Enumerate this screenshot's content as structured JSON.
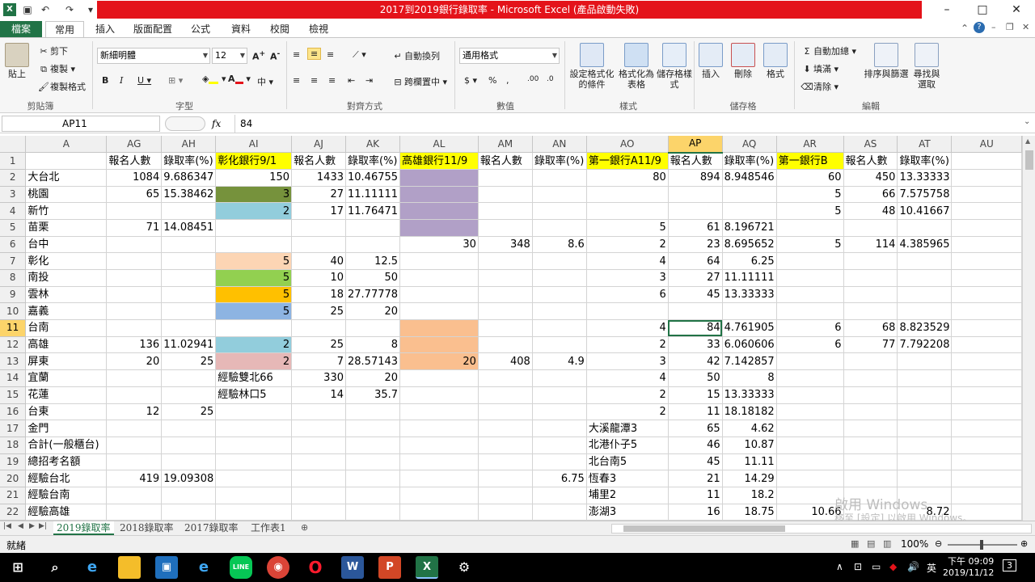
{
  "window": {
    "title": "2017到2019銀行錄取率 - Microsoft Excel (產品啟動失敗)",
    "controls": [
      "–",
      "□",
      "✕"
    ]
  },
  "ribbon_tabs": [
    "檔案",
    "常用",
    "插入",
    "版面配置",
    "公式",
    "資料",
    "校閱",
    "檢視"
  ],
  "ribbon": {
    "clipboard": {
      "paste": "貼上",
      "cut": "剪下",
      "copy": "複製",
      "format_painter": "複製格式",
      "label": "剪貼簿"
    },
    "font": {
      "name": "新細明體",
      "size": "12",
      "label": "字型"
    },
    "alignment": {
      "wrap": "自動換列",
      "merge": "跨欄置中",
      "label": "對齊方式"
    },
    "number": {
      "format": "通用格式",
      "label": "數值"
    },
    "styles": {
      "conditional": "設定格式化的條件",
      "table": "格式化為表格",
      "cell_styles": "儲存格樣式",
      "label": "樣式"
    },
    "cells": {
      "insert": "插入",
      "delete": "刪除",
      "format": "格式",
      "label": "儲存格"
    },
    "editing": {
      "autosum": "自動加總",
      "fill": "填滿",
      "clear": "清除",
      "sort": "排序與篩選",
      "find": "尋找與選取",
      "label": "編輯"
    }
  },
  "formula_bar": {
    "name_box": "AP11",
    "fx": "fx",
    "value": "84"
  },
  "columns": [
    "A",
    "AG",
    "AH",
    "AI",
    "AJ",
    "AK",
    "AL",
    "AM",
    "AN",
    "AO",
    "AP",
    "AQ",
    "AR",
    "AS",
    "AT",
    "AU"
  ],
  "rows": [
    [
      "",
      "報名人數",
      "錄取率(%)",
      "彰化銀行9/1",
      "報名人數",
      "錄取率(%)",
      "高雄銀行11/9",
      "報名人數",
      "錄取率(%)",
      "第一銀行A11/9",
      "報名人數",
      "錄取率(%)",
      "第一銀行B",
      "報名人數",
      "錄取率(%)",
      ""
    ],
    [
      "大台北",
      "1084",
      "9.686347",
      "150",
      "1433",
      "10.46755",
      "",
      "",
      "",
      "80",
      "894",
      "8.948546",
      "60",
      "450",
      "13.33333",
      ""
    ],
    [
      "桃園",
      "65",
      "15.38462",
      "3",
      "27",
      "11.11111",
      "",
      "",
      "",
      "",
      "",
      "",
      "5",
      "66",
      "7.575758",
      ""
    ],
    [
      "新竹",
      "",
      "",
      "2",
      "17",
      "11.76471",
      "",
      "",
      "",
      "",
      "",
      "",
      "5",
      "48",
      "10.41667",
      ""
    ],
    [
      "苗栗",
      "71",
      "14.08451",
      "",
      "",
      "",
      "",
      "",
      "",
      "5",
      "61",
      "8.196721",
      "",
      "",
      "",
      ""
    ],
    [
      "台中",
      "",
      "",
      "",
      "",
      "",
      "30",
      "348",
      "8.6",
      "2",
      "23",
      "8.695652",
      "5",
      "114",
      "4.385965",
      ""
    ],
    [
      "彰化",
      "",
      "",
      "5",
      "40",
      "12.5",
      "",
      "",
      "",
      "4",
      "64",
      "6.25",
      "",
      "",
      "",
      ""
    ],
    [
      "南投",
      "",
      "",
      "5",
      "10",
      "50",
      "",
      "",
      "",
      "3",
      "27",
      "11.11111",
      "",
      "",
      "",
      ""
    ],
    [
      "雲林",
      "",
      "",
      "5",
      "18",
      "27.77778",
      "",
      "",
      "",
      "6",
      "45",
      "13.33333",
      "",
      "",
      "",
      ""
    ],
    [
      "嘉義",
      "",
      "",
      "5",
      "25",
      "20",
      "",
      "",
      "",
      "",
      "",
      "",
      "",
      "",
      "",
      ""
    ],
    [
      "台南",
      "",
      "",
      "",
      "",
      "",
      "",
      "",
      "",
      "4",
      "84",
      "4.761905",
      "6",
      "68",
      "8.823529",
      ""
    ],
    [
      "高雄",
      "136",
      "11.02941",
      "2",
      "25",
      "8",
      "",
      "",
      "",
      "2",
      "33",
      "6.060606",
      "6",
      "77",
      "7.792208",
      ""
    ],
    [
      "屏東",
      "20",
      "25",
      "2",
      "7",
      "28.57143",
      "20",
      "408",
      "4.9",
      "3",
      "42",
      "7.142857",
      "",
      "",
      "",
      ""
    ],
    [
      "宜蘭",
      "",
      "",
      "經驗雙北66",
      "330",
      "20",
      "",
      "",
      "",
      "4",
      "50",
      "8",
      "",
      "",
      "",
      ""
    ],
    [
      "花蓮",
      "",
      "",
      "經驗林口5",
      "14",
      "35.7",
      "",
      "",
      "",
      "2",
      "15",
      "13.33333",
      "",
      "",
      "",
      ""
    ],
    [
      "台東",
      "12",
      "25",
      "",
      "",
      "",
      "",
      "",
      "",
      "2",
      "11",
      "18.18182",
      "",
      "",
      "",
      ""
    ],
    [
      "金門",
      "",
      "",
      "",
      "",
      "",
      "",
      "",
      "",
      "大溪龍潭3",
      "65",
      "4.62",
      "",
      "",
      "",
      ""
    ],
    [
      "合計(一般櫃台)",
      "",
      "",
      "",
      "",
      "",
      "",
      "",
      "",
      "北港仆子5",
      "46",
      "10.87",
      "",
      "",
      "",
      ""
    ],
    [
      "總招考名額",
      "",
      "",
      "",
      "",
      "",
      "",
      "",
      "",
      "北台南5",
      "45",
      "11.11",
      "",
      "",
      "",
      ""
    ],
    [
      "經驗台北",
      "419",
      "19.09308",
      "",
      "",
      "",
      "",
      "",
      "6.75",
      "恆春3",
      "21",
      "14.29",
      "",
      "",
      "",
      ""
    ],
    [
      "經驗台南",
      "",
      "",
      "",
      "",
      "",
      "",
      "",
      "",
      "埔里2",
      "11",
      "18.2",
      "",
      "",
      "",
      ""
    ],
    [
      "經驗高雄",
      "",
      "",
      "",
      "",
      "",
      "",
      "",
      "",
      "澎湖3",
      "16",
      "18.75",
      "10.66",
      "",
      "8.72",
      ""
    ]
  ],
  "sheet_tabs": [
    "2019錄取率",
    "2018錄取率",
    "2017錄取率",
    "工作表1"
  ],
  "status": {
    "ready": "就緒",
    "zoom": "100%"
  },
  "watermark": {
    "line1": "啟用 Windows",
    "line2": "移至 [設定] 以啟用 Windows。"
  },
  "taskbar": {
    "time": "下午 09:09",
    "date": "2019/11/12",
    "ime": "英",
    "notifications": "3"
  },
  "colors": {
    "excel_green": "#217346",
    "title_red": "#e4131a",
    "header_yellow": "#ffff00",
    "select_orange": "#fcd46a"
  }
}
